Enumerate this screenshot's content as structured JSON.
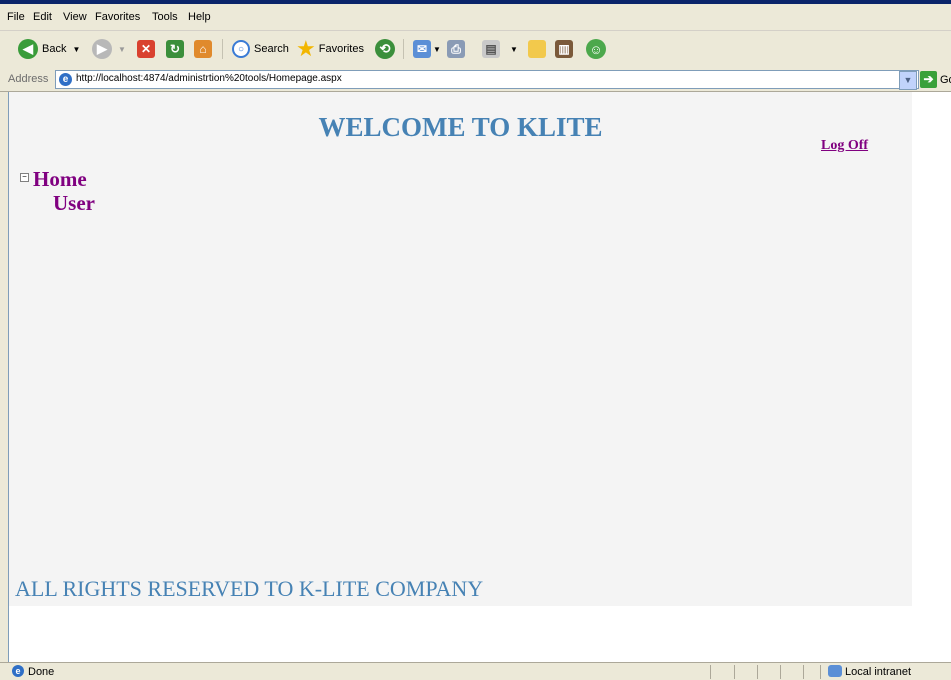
{
  "menu": [
    "File",
    "Edit",
    "View",
    "Favorites",
    "Tools",
    "Help"
  ],
  "toolbar": {
    "back_label": "Back",
    "search_label": "Search",
    "favorites_label": "Favorites"
  },
  "address": {
    "label": "Address",
    "url": "http://localhost:4874/administrtion%20tools/Homepage.aspx",
    "go_label": "Go"
  },
  "page": {
    "title": "WELCOME TO KLITE",
    "logoff_label": "Log Off",
    "tree": {
      "toggle": "−",
      "items": [
        "Home",
        "User"
      ]
    },
    "footer": "ALL RIGHTS RESERVED TO K-LITE COMPANY"
  },
  "status": {
    "text": "Done",
    "zone": "Local intranet"
  },
  "colors": {
    "title": "#4682b4",
    "link": "#800080",
    "panel_bg": "#f4f4f4"
  },
  "icons": [
    "back-icon",
    "forward-icon",
    "stop-icon",
    "refresh-icon",
    "home-icon",
    "search-icon",
    "favorites-star-icon",
    "history-icon",
    "mail-icon",
    "print-icon",
    "edit-icon",
    "folder-icon",
    "research-icon",
    "messenger-icon",
    "ie-page-icon",
    "go-arrow-icon",
    "intranet-icon"
  ]
}
